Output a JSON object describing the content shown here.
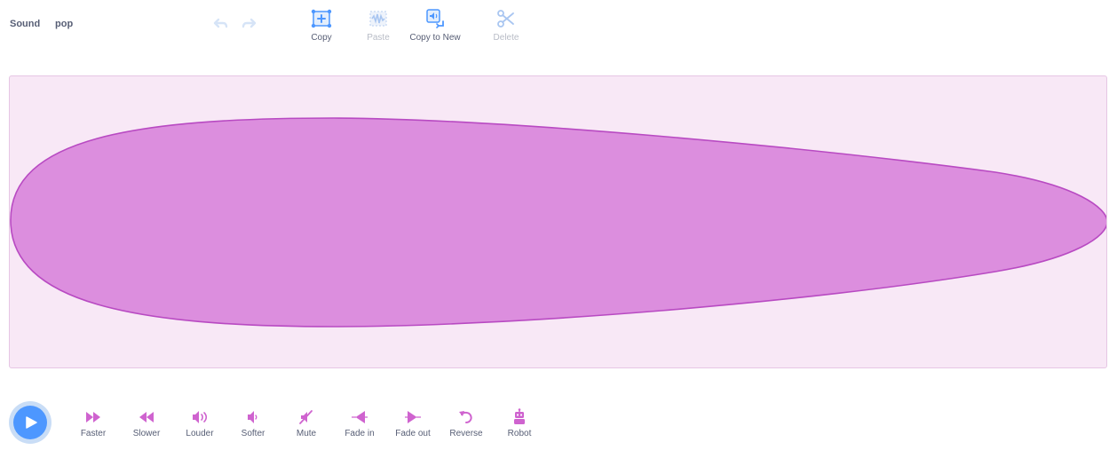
{
  "header": {
    "sound_label": "Sound",
    "sound_name": "pop"
  },
  "history": {
    "undo_icon": "undo-icon",
    "redo_icon": "redo-icon"
  },
  "toolbar": {
    "copy": "Copy",
    "paste": "Paste",
    "copy_to_new": "Copy to New",
    "delete": "Delete"
  },
  "effects": {
    "faster": "Faster",
    "slower": "Slower",
    "louder": "Louder",
    "softer": "Softer",
    "mute": "Mute",
    "fade_in": "Fade in",
    "fade_out": "Fade out",
    "reverse": "Reverse",
    "robot": "Robot"
  },
  "colors": {
    "accent": "#4d97ff",
    "sound_magenta": "#cf63cf",
    "wave_fill": "#dc8ede",
    "wave_stroke": "#b84ac2",
    "wave_bg": "#f8e8f6",
    "disabled": "#b8bcc6"
  }
}
